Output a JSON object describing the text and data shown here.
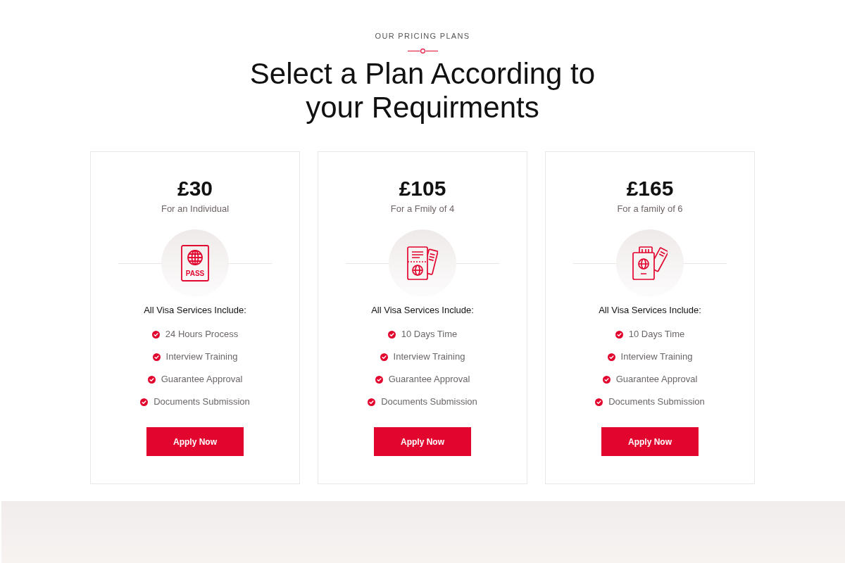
{
  "section": {
    "eyebrow": "OUR PRICING PLANS",
    "title": "Select a Plan According to your Requirments"
  },
  "plans": [
    {
      "price": "£30",
      "subtitle": "For an Individual",
      "kind": "passport",
      "icon_text": "PASS",
      "features_heading": "All Visa Services Include:",
      "features": [
        "24 Hours Process",
        "Interview Training",
        "Guarantee Approval",
        "Documents Submission"
      ],
      "button": "Apply Now"
    },
    {
      "price": "£105",
      "subtitle": "For a Fmily of 4",
      "kind": "documents",
      "features_heading": "All Visa Services Include:",
      "features": [
        "10 Days Time",
        "Interview Training",
        "Guarantee Approval",
        "Documents Submission"
      ],
      "button": "Apply Now"
    },
    {
      "price": "£165",
      "subtitle": "For a family of 6",
      "kind": "tickets",
      "features_heading": "All Visa Services Include:",
      "features": [
        "10 Days Time",
        "Interview Training",
        "Guarantee Approval",
        "Documents Submission"
      ],
      "button": "Apply Now"
    }
  ]
}
